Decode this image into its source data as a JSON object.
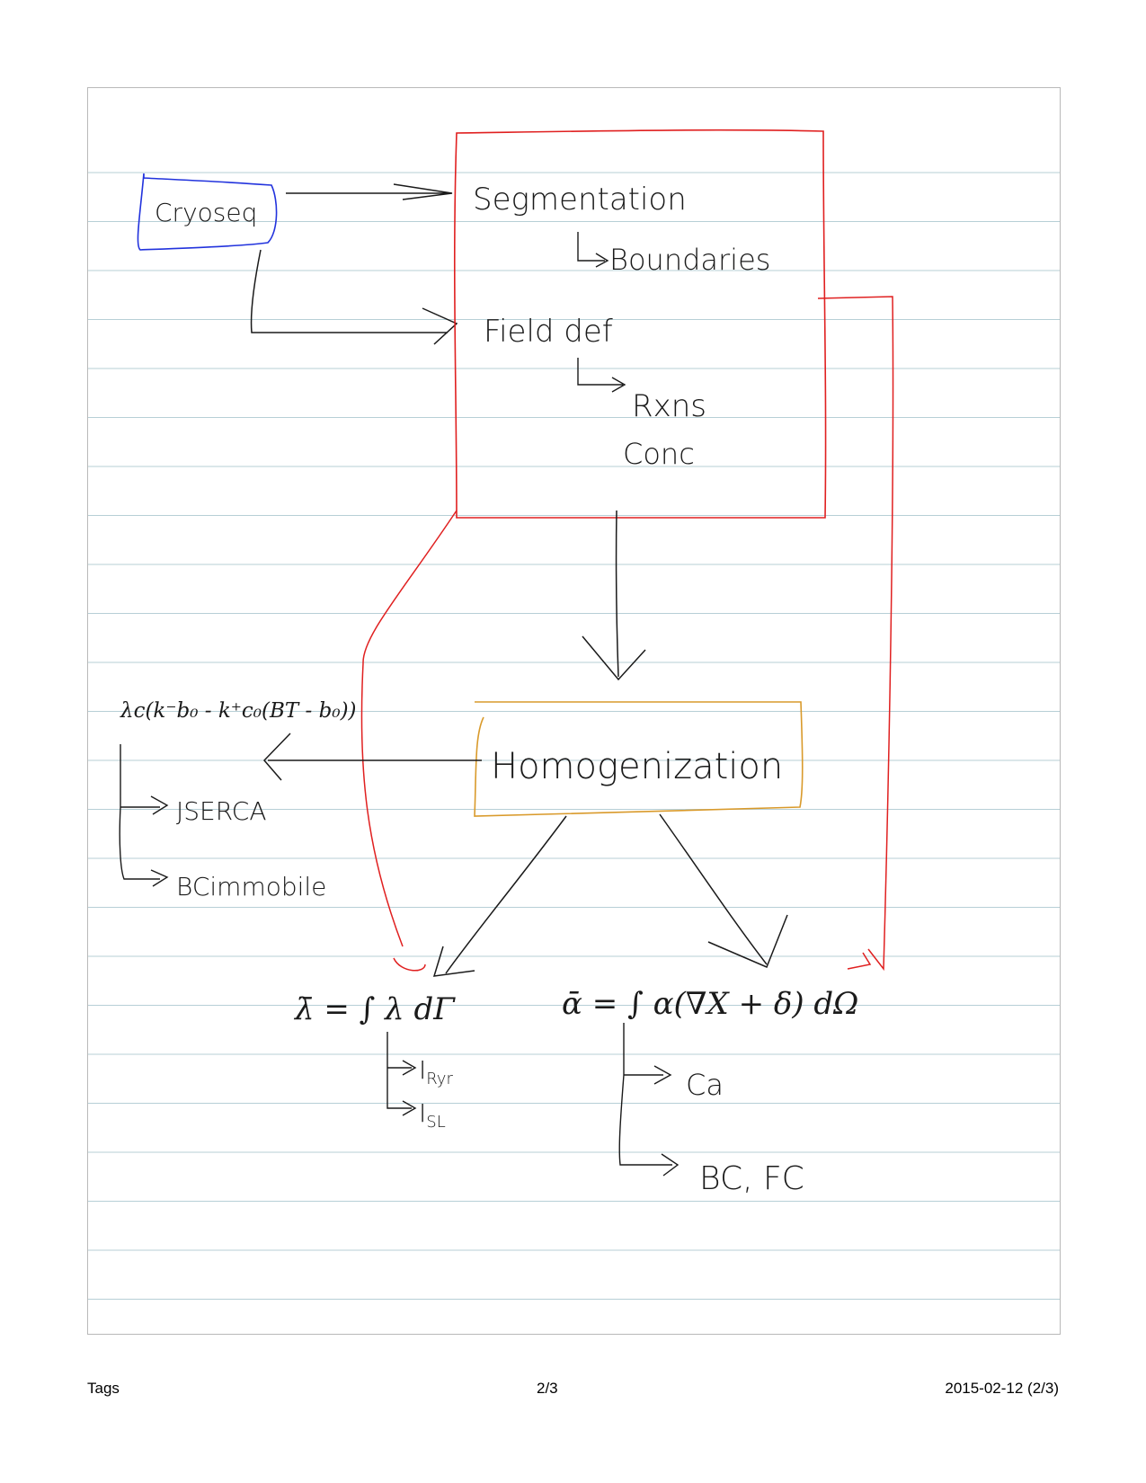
{
  "colors": {
    "ruled_line": "#b7cfd6",
    "ink": "#1a1a1a",
    "red_ink": "#e02020",
    "blue_ink": "#2233dd",
    "orange_ink": "#d99a2b"
  },
  "diagram": {
    "cryoseq": "Cryoseq",
    "segmentation": "Segmentation",
    "boundaries": "Boundaries",
    "field_def": "Field def",
    "rxns": "Rxns",
    "conc": "Conc",
    "homogenization": "Homogenization",
    "flux_expr": "λc(k⁻b₀ - k⁺c₀(BT - b₀))",
    "jserca": "JSERCA",
    "bc_immobile": "BCimmobile",
    "lambda_avg": "λ̄ = ∫ λ dΓ",
    "i_ryr_main": "I",
    "i_ryr_sub": "Ryr",
    "i_sl_main": "I",
    "i_sl_sub": "SL",
    "alpha_avg": "ᾱ = ∫ α(∇X + δ) dΩ",
    "ca": "Ca",
    "bc_fc": "BC, FC"
  },
  "footer": {
    "left": "Tags",
    "center": "2/3",
    "right": "2015-02-12 (2/3)"
  }
}
